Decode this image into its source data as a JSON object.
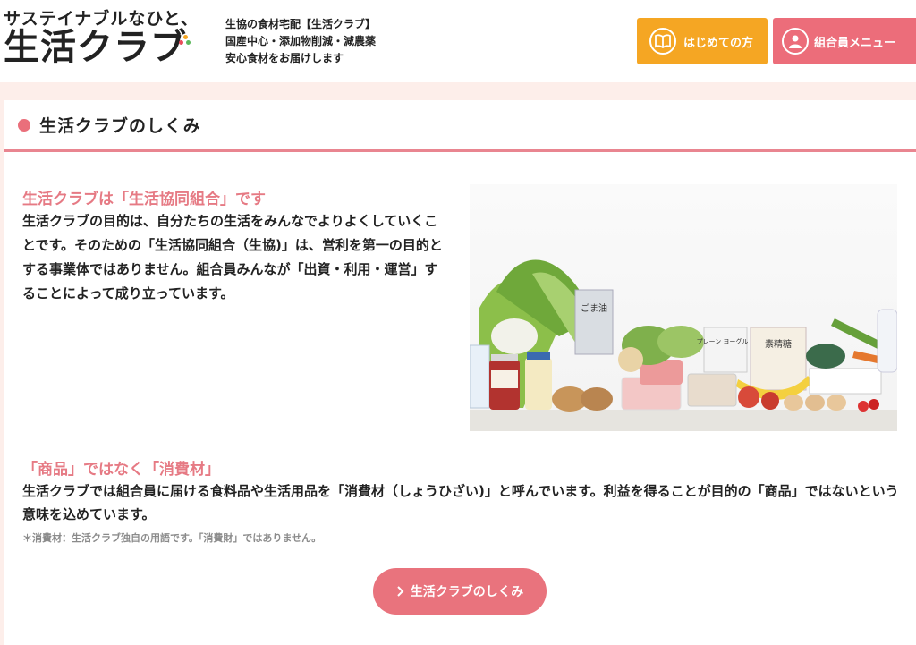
{
  "header": {
    "logo_tagline": "サステイナブルなひと、",
    "logo_main": "生活クラブ",
    "logo_dot_colors": [
      "#e94b5a",
      "#f5a623",
      "#5cb85c"
    ],
    "desc_lines": [
      "生協の食材宅配【生活クラブ】",
      "国産中心・添加物削減・減農薬",
      "安心食材をお届けします"
    ],
    "btn_beginner": "はじめての方",
    "btn_member": "組合員メニュー"
  },
  "section": {
    "title": "生活クラブのしくみ"
  },
  "block1": {
    "heading": "生活クラブは「生活協同組合」です",
    "body": "生活クラブの目的は、自分たちの生活をみんなでよりよくしていくことです。そのための「生活協同組合（生協)」は、営利を第一の目的とする事業体ではありません。組合員みんなが「出資・利用・運営」することによって成り立っています。"
  },
  "block2": {
    "heading": "「商品」ではなく「消費材」",
    "body": "生活クラブでは組合員に届ける食料品や生活用品を「消費材（しょうひざい)」と呼んでいます。利益を得ることが目的の「商品」ではないという意味を込めています。",
    "note": "＊消費材：生活クラブ独自の用語です。「消費財」ではありません。"
  },
  "cta": {
    "label": "生活クラブのしくみ"
  },
  "photo_labels": {
    "sesame": "ごま油",
    "yogurt": "プレーン ヨーグルト",
    "flour": "素精糖"
  },
  "colors": {
    "accent_pink": "#ea6f7b",
    "accent_orange": "#f5a623",
    "page_bg": "#fdeeea"
  }
}
